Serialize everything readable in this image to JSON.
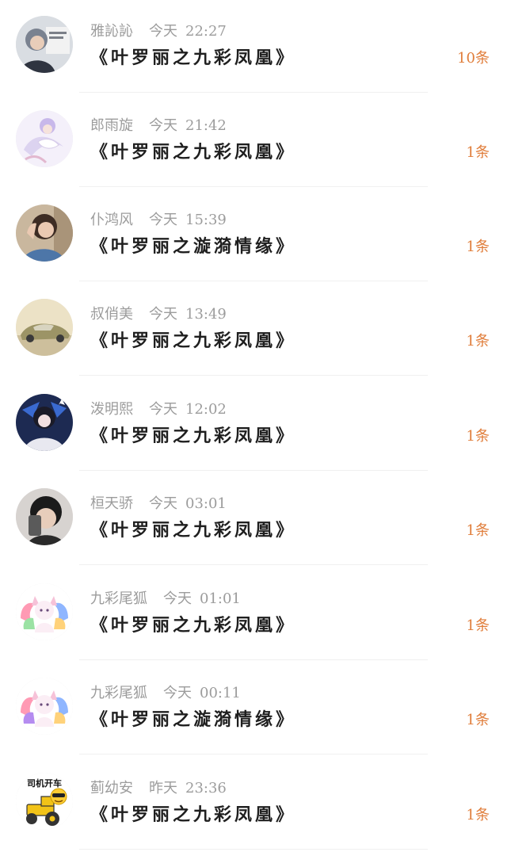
{
  "colors": {
    "background": "#ffffff",
    "name_text": "#9c9c9c",
    "title_text": "#1f1f1f",
    "count_text": "#e07d3a",
    "divider": "#f0f0f0"
  },
  "conversations": [
    {
      "name": "雅訫訫",
      "day": "今天",
      "time": "22:27",
      "title": "《叶罗丽之九彩凤凰》",
      "count": "10条",
      "avatar_icon": "girl-photo-avatar"
    },
    {
      "name": "郎雨旋",
      "day": "今天",
      "time": "21:42",
      "title": "《叶罗丽之九彩凤凰》",
      "count": "1条",
      "avatar_icon": "anime-fairy-avatar"
    },
    {
      "name": "仆鸿风",
      "day": "今天",
      "time": "15:39",
      "title": "《叶罗丽之漩漪情缘》",
      "count": "1条",
      "avatar_icon": "girl-portrait-avatar"
    },
    {
      "name": "叔俏美",
      "day": "今天",
      "time": "13:49",
      "title": "《叶罗丽之九彩凤凰》",
      "count": "1条",
      "avatar_icon": "car-avatar"
    },
    {
      "name": "泼明熙",
      "day": "今天",
      "time": "12:02",
      "title": "《叶罗丽之九彩凤凰》",
      "count": "1条",
      "avatar_icon": "anime-character-avatar"
    },
    {
      "name": "桓天骄",
      "day": "今天",
      "time": "03:01",
      "title": "《叶罗丽之九彩凤凰》",
      "count": "1条",
      "avatar_icon": "boy-selfie-avatar"
    },
    {
      "name": "九彩尾狐",
      "day": "今天",
      "time": "01:01",
      "title": "《叶罗丽之九彩凤凰》",
      "count": "1条",
      "avatar_icon": "rainbow-fox-avatar"
    },
    {
      "name": "九彩尾狐",
      "day": "今天",
      "time": "00:11",
      "title": "《叶罗丽之漩漪情缘》",
      "count": "1条",
      "avatar_icon": "rainbow-fox-avatar"
    },
    {
      "name": "蓟幼安",
      "day": "昨天",
      "time": "23:36",
      "title": "《叶罗丽之九彩凤凰》",
      "count": "1条",
      "avatar_icon": "tractor-emoji-avatar",
      "avatar_text": "司机开车"
    }
  ]
}
